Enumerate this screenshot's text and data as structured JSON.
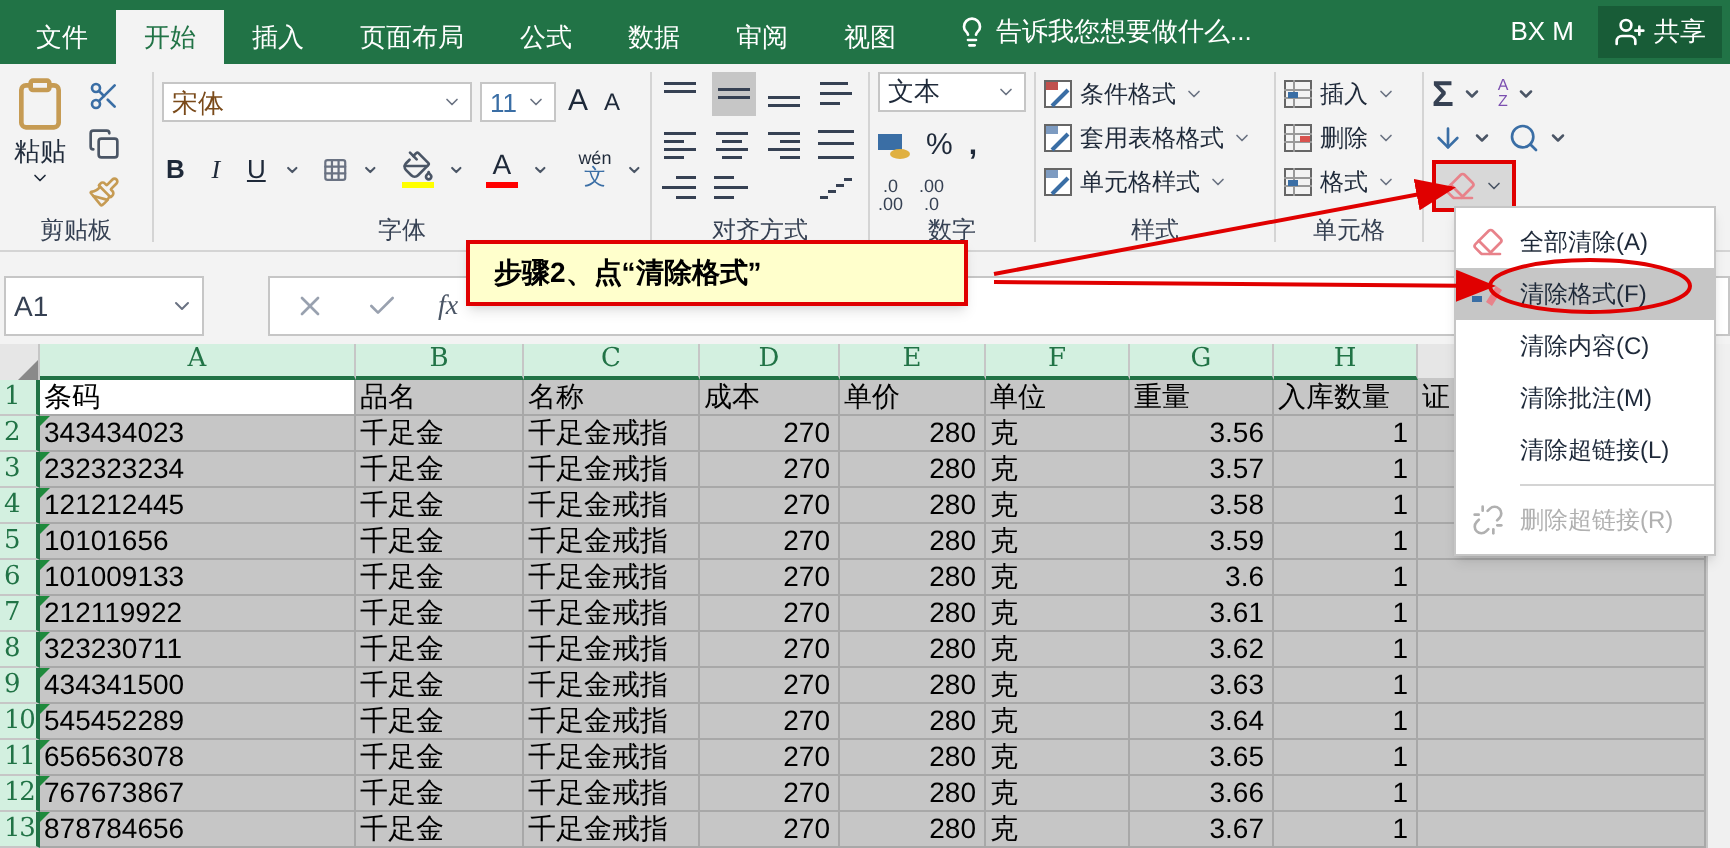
{
  "title_bar": {
    "tabs": [
      {
        "label": "文件",
        "selected": false
      },
      {
        "label": "开始",
        "selected": true
      },
      {
        "label": "插入",
        "selected": false
      },
      {
        "label": "页面布局",
        "selected": false
      },
      {
        "label": "公式",
        "selected": false
      },
      {
        "label": "数据",
        "selected": false
      },
      {
        "label": "审阅",
        "selected": false
      },
      {
        "label": "视图",
        "selected": false
      }
    ],
    "tell_me": "告诉我您想要做什么...",
    "user": "BX M",
    "share": "共享"
  },
  "ribbon": {
    "clipboard": {
      "paste": "粘贴",
      "label": "剪贴板"
    },
    "font": {
      "name": "宋体",
      "size": "11",
      "grow": "A",
      "shrink": "A",
      "bold": "B",
      "italic": "I",
      "underline": "U",
      "font_color_letter": "A",
      "phonetic_top": "wén",
      "phonetic_bottom": "文",
      "label": "字体"
    },
    "alignment": {
      "label": "对齐方式"
    },
    "number": {
      "format": "文本",
      "percent": "%",
      "comma": ",",
      "decimals": [
        {
          "top": ".0",
          "bottom": ".00"
        },
        {
          "top": ".00",
          "bottom": ".0"
        }
      ],
      "label": "数字"
    },
    "styles": {
      "items": [
        "条件格式",
        "套用表格格式",
        "单元格样式"
      ],
      "label": "样式"
    },
    "cells": {
      "items": [
        "插入",
        "删除",
        "格式"
      ],
      "label": "单元格"
    },
    "editing": {
      "sum": "Σ",
      "sort_top": "A",
      "sort_bottom": "Z",
      "clear_highlighted": true
    }
  },
  "formula_bar": {
    "name_box": "A1",
    "fx": "fx"
  },
  "sheet": {
    "columns": [
      {
        "letter": "A",
        "selected": true,
        "numeric": false
      },
      {
        "letter": "B",
        "selected": true,
        "numeric": false
      },
      {
        "letter": "C",
        "selected": true,
        "numeric": false
      },
      {
        "letter": "D",
        "selected": true,
        "numeric": true
      },
      {
        "letter": "E",
        "selected": true,
        "numeric": true
      },
      {
        "letter": "F",
        "selected": true,
        "numeric": false
      },
      {
        "letter": "G",
        "selected": true,
        "numeric": true
      },
      {
        "letter": "H",
        "selected": true,
        "numeric": true
      }
    ],
    "rows": [
      {
        "number": "1",
        "kind": "header",
        "active": true,
        "flagged": false,
        "cells": [
          "条码",
          "品名",
          "名称",
          "成本",
          "单价",
          "单位",
          "重量",
          "入库数量",
          "证"
        ]
      },
      {
        "number": "2",
        "kind": "data",
        "active": false,
        "flagged": true,
        "cells": [
          "343434023",
          "千足金",
          "千足金戒指",
          "270",
          "280",
          "克",
          "3.56",
          "1"
        ]
      },
      {
        "number": "3",
        "kind": "data",
        "active": false,
        "flagged": true,
        "cells": [
          "232323234",
          "千足金",
          "千足金戒指",
          "270",
          "280",
          "克",
          "3.57",
          "1"
        ]
      },
      {
        "number": "4",
        "kind": "data",
        "active": false,
        "flagged": true,
        "cells": [
          "121212445",
          "千足金",
          "千足金戒指",
          "270",
          "280",
          "克",
          "3.58",
          "1"
        ]
      },
      {
        "number": "5",
        "kind": "data",
        "active": false,
        "flagged": true,
        "cells": [
          "10101656",
          "千足金",
          "千足金戒指",
          "270",
          "280",
          "克",
          "3.59",
          "1"
        ]
      },
      {
        "number": "6",
        "kind": "data",
        "active": false,
        "flagged": true,
        "cells": [
          "101009133",
          "千足金",
          "千足金戒指",
          "270",
          "280",
          "克",
          "3.6",
          "1"
        ]
      },
      {
        "number": "7",
        "kind": "data",
        "active": false,
        "flagged": true,
        "cells": [
          "212119922",
          "千足金",
          "千足金戒指",
          "270",
          "280",
          "克",
          "3.61",
          "1"
        ]
      },
      {
        "number": "8",
        "kind": "data",
        "active": false,
        "flagged": true,
        "cells": [
          "323230711",
          "千足金",
          "千足金戒指",
          "270",
          "280",
          "克",
          "3.62",
          "1"
        ]
      },
      {
        "number": "9",
        "kind": "data",
        "active": false,
        "flagged": true,
        "cells": [
          "434341500",
          "千足金",
          "千足金戒指",
          "270",
          "280",
          "克",
          "3.63",
          "1"
        ]
      },
      {
        "number": "10",
        "kind": "data",
        "active": false,
        "flagged": true,
        "cells": [
          "545452289",
          "千足金",
          "千足金戒指",
          "270",
          "280",
          "克",
          "3.64",
          "1"
        ]
      },
      {
        "number": "11",
        "kind": "data",
        "active": false,
        "flagged": true,
        "cells": [
          "656563078",
          "千足金",
          "千足金戒指",
          "270",
          "280",
          "克",
          "3.65",
          "1"
        ]
      },
      {
        "number": "12",
        "kind": "data",
        "active": false,
        "flagged": true,
        "cells": [
          "767673867",
          "千足金",
          "千足金戒指",
          "270",
          "280",
          "克",
          "3.66",
          "1"
        ]
      },
      {
        "number": "13",
        "kind": "data",
        "active": false,
        "flagged": true,
        "cells": [
          "878784656",
          "千足金",
          "千足金戒指",
          "270",
          "280",
          "克",
          "3.67",
          "1"
        ]
      }
    ]
  },
  "callout": {
    "text": "步骤2、点“清除格式”"
  },
  "clear_menu": {
    "items": [
      {
        "label": "全部清除(A)",
        "kind": "eraser",
        "selected": false,
        "disabled": false,
        "separator_before": false
      },
      {
        "label": "清除格式(F)",
        "kind": "format",
        "selected": true,
        "disabled": false,
        "separator_before": false
      },
      {
        "label": "清除内容(C)",
        "kind": "plain",
        "selected": false,
        "disabled": false,
        "separator_before": false
      },
      {
        "label": "清除批注(M)",
        "kind": "plain",
        "selected": false,
        "disabled": false,
        "separator_before": false
      },
      {
        "label": "清除超链接(L)",
        "kind": "plain",
        "selected": false,
        "disabled": false,
        "separator_before": false
      },
      {
        "label": "删除超链接(R)",
        "kind": "unlink",
        "selected": false,
        "disabled": true,
        "separator_before": true
      }
    ]
  }
}
